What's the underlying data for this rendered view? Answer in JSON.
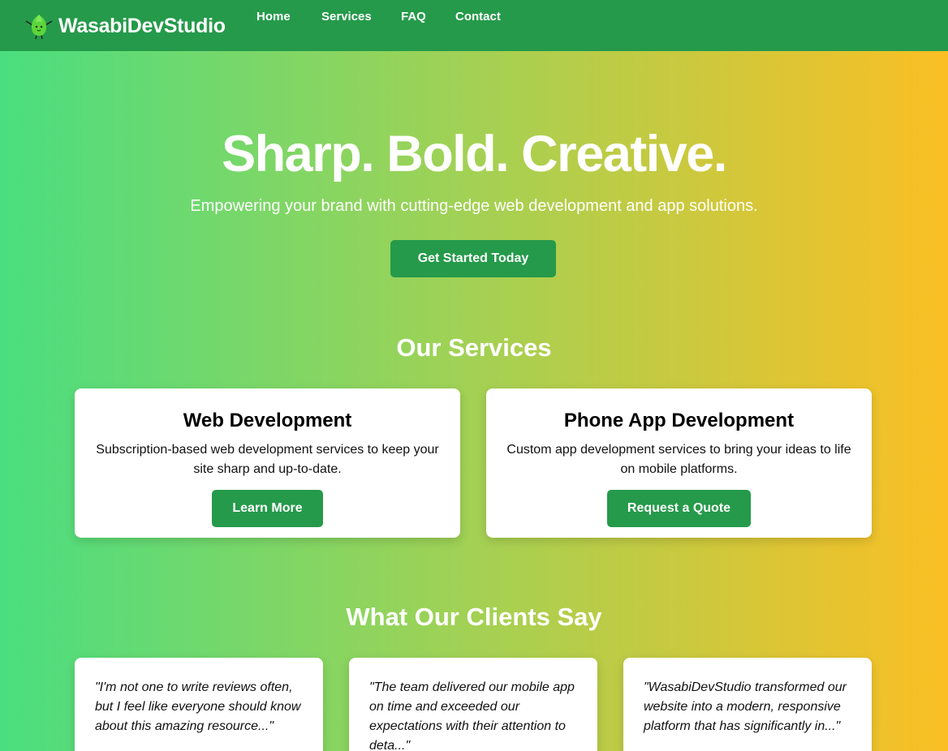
{
  "header": {
    "brand_name": "WasabiDevStudio",
    "logo_icon": "wasabi-mascot-icon",
    "nav": [
      {
        "label": "Home"
      },
      {
        "label": "Services"
      },
      {
        "label": "FAQ"
      },
      {
        "label": "Contact"
      }
    ]
  },
  "hero": {
    "title": "Sharp. Bold. Creative.",
    "subtitle": "Empowering your brand with cutting-edge web development and app solutions.",
    "cta_label": "Get Started Today"
  },
  "services": {
    "heading": "Our Services",
    "items": [
      {
        "title": "Web Development",
        "description": "Subscription-based web development services to keep your site sharp and up-to-date.",
        "button_label": "Learn More"
      },
      {
        "title": "Phone App Development",
        "description": "Custom app development services to bring your ideas to life on mobile platforms.",
        "button_label": "Request a Quote"
      }
    ]
  },
  "testimonials": {
    "heading": "What Our Clients Say",
    "items": [
      {
        "quote": "\"I'm not one to write reviews often, but I feel like everyone should know about this amazing resource...\""
      },
      {
        "quote": "\"The team delivered our mobile app on time and exceeded our expectations with their attention to deta...\""
      },
      {
        "quote": "\"WasabiDevStudio transformed our website into a modern, responsive platform that has significantly in...\""
      }
    ]
  },
  "colors": {
    "brand_green": "#259a4a",
    "gradient_start": "#4ade80",
    "gradient_end": "#fbbf24",
    "card_bg": "#ffffff"
  }
}
